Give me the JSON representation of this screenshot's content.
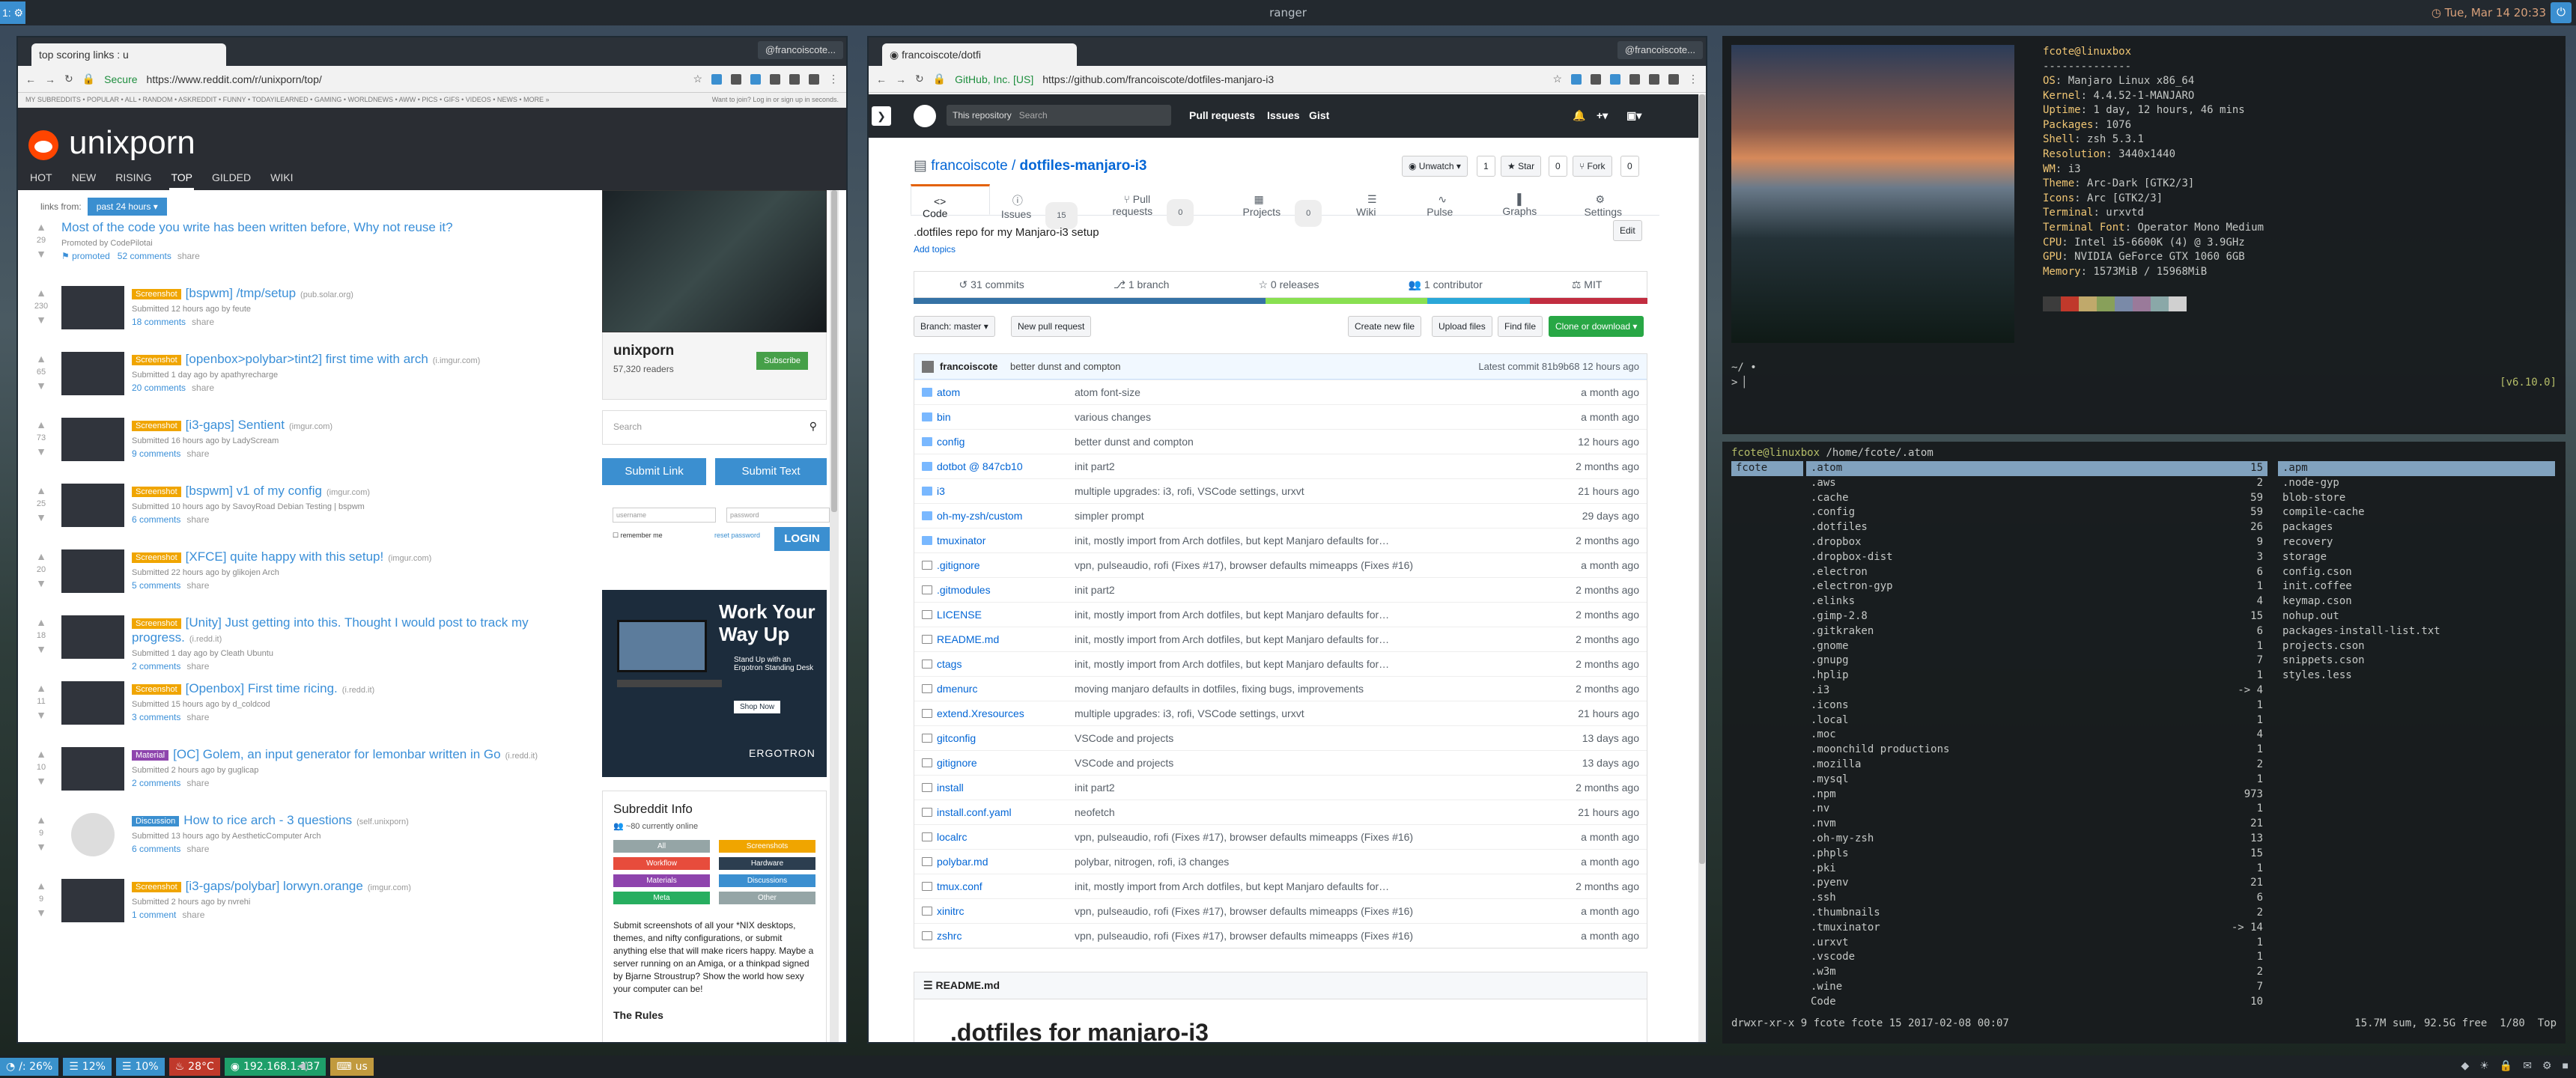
{
  "topbar": {
    "workspace": "1: ⚙",
    "title": "ranger",
    "clock": "◷ Tue, Mar 14 20:33",
    "power": "⏻"
  },
  "bottombar": {
    "items": [
      {
        "label": "/: 26%",
        "color": "#3a92cc"
      },
      {
        "label": "12%",
        "color": "#3a92cc"
      },
      {
        "label": "10%",
        "color": "#3a92cc"
      },
      {
        "label": "28°C",
        "color": "#c0392b"
      },
      {
        "label": "192.168.1.137",
        "color": "#1e9f6a"
      },
      {
        "label": "us",
        "color": "#c19a3e"
      }
    ],
    "volume": "◀)"
  },
  "reddit": {
    "tab": "top scoring links : u",
    "profile": "@francoiscote...",
    "secure": "Secure",
    "url": "https://www.reddit.com/r/unixporn/top/",
    "strip": "MY SUBREDDITS • POPULAR • ALL • RANDOM • ASKREDDIT • FUNNY • TODAYILEARNED • GAMING • WORLDNEWS • AWW • PICS • GIFS • VIDEOS • NEWS • MORE »",
    "login_prompt": "Want to join? Log in or sign up in seconds.",
    "sub": "unixporn",
    "tabs": [
      "HOT",
      "NEW",
      "RISING",
      "TOP",
      "GILDED",
      "WIKI"
    ],
    "links_from": "links from:",
    "filter": "past 24 hours ▾",
    "posts": [
      {
        "title": "Most of the code you write has been written before, Why not reuse it?",
        "flair": "",
        "domain": "",
        "score": "29",
        "meta": "Promoted by CodePilotai",
        "comments": "52 comments",
        "share": "share",
        "promoted": "⚑ promoted"
      },
      {
        "title": "[bspwm] /tmp/setup",
        "flair": "Screenshot",
        "domain": "(pub.solar.org)",
        "score": "230",
        "meta": "Submitted 12 hours ago by feute",
        "comments": "18 comments",
        "share": "share"
      },
      {
        "title": "[openbox>polybar>tint2] first time with arch",
        "flair": "Screenshot",
        "domain": "(i.imgur.com)",
        "score": "65",
        "meta": "Submitted 1 day ago by apathyrecharge",
        "comments": "20 comments",
        "share": "share"
      },
      {
        "title": "[i3-gaps] Sentient",
        "flair": "Screenshot",
        "domain": "(imgur.com)",
        "score": "73",
        "meta": "Submitted 16 hours ago by LadyScream",
        "comments": "9 comments",
        "share": "share"
      },
      {
        "title": "[bspwm] v1 of my config",
        "flair": "Screenshot",
        "domain": "(imgur.com)",
        "score": "25",
        "meta": "Submitted 10 hours ago by SavoyRoad  Debian Testing | bspwm",
        "comments": "6 comments",
        "share": "share"
      },
      {
        "title": "[XFCE] quite happy with this setup!",
        "flair": "Screenshot",
        "domain": "(imgur.com)",
        "score": "20",
        "meta": "Submitted 22 hours ago by glikojen  Arch",
        "comments": "5 comments",
        "share": "share"
      },
      {
        "title": "[Unity] Just getting into this. Thought I would post to track my progress.",
        "flair": "Screenshot",
        "domain": "(i.redd.it)",
        "score": "18",
        "meta": "Submitted 1 day ago by Cleath  Ubuntu",
        "comments": "2 comments",
        "share": "share"
      },
      {
        "title": "[Openbox] First time ricing.",
        "flair": "Screenshot",
        "domain": "(i.redd.it)",
        "score": "11",
        "meta": "Submitted 15 hours ago by d_coldcod",
        "comments": "3 comments",
        "share": "share"
      },
      {
        "title": "[OC] Golem, an input generator for lemonbar written in Go",
        "flair": "Material",
        "domain": "(i.redd.it)",
        "score": "10",
        "meta": "Submitted 2 hours ago by guglicap",
        "comments": "2 comments",
        "share": "share"
      },
      {
        "title": "How to rice arch - 3 questions",
        "flair": "Discussion",
        "domain": "(self.unixporn)",
        "score": "9",
        "meta": "Submitted 13 hours ago by AestheticComputer  Arch",
        "comments": "6 comments",
        "share": "share"
      },
      {
        "title": "[i3-gaps/polybar] lorwyn.orange",
        "flair": "Screenshot",
        "domain": "(imgur.com)",
        "score": "9",
        "meta": "Submitted 2 hours ago by nvrehi",
        "comments": "1 comment",
        "share": "share"
      }
    ],
    "side": {
      "sub": "unixporn",
      "readers": "57,320 readers",
      "subscribe": "Subscribe",
      "search": "Search",
      "submit_link": "Submit Link",
      "submit_text": "Submit Text",
      "username": "username",
      "password": "password",
      "remember": "remember me",
      "reset": "reset password",
      "login": "LOGIN",
      "ad_title": "Work Your Way Up",
      "ad_sub": "Stand Up with an Ergotron Standing Desk",
      "ad_btn": "Shop Now",
      "ad_brand": "ERGOTRON",
      "info_title": "Subreddit Info",
      "online": "~80 currently online",
      "tags": [
        {
          "l": "All",
          "c": "#95a5a6"
        },
        {
          "l": "Screenshots",
          "c": "#f0a500"
        },
        {
          "l": "Workflow",
          "c": "#e74c3c"
        },
        {
          "l": "Hardware",
          "c": "#2c3e50"
        },
        {
          "l": "Materials",
          "c": "#8e44ad"
        },
        {
          "l": "Discussions",
          "c": "#3b8fd0"
        },
        {
          "l": "Meta",
          "c": "#27ae60"
        },
        {
          "l": "Other",
          "c": "#95a5a6"
        }
      ],
      "desc": "Submit screenshots of all your *NIX desktops, themes, and nifty configurations, or submit anything else that will make ricers happy. Maybe a server running on an Amiga, or a thinkpad signed by Bjarne Stroustrup? Show the world how sexy your computer can be!",
      "rules": "The Rules"
    }
  },
  "github": {
    "tab": "francoiscote/dotfi",
    "profile": "@francoiscote...",
    "secure": "GitHub, Inc. [US]",
    "url": "https://github.com/francoiscote/dotfiles-manjaro-i3",
    "repo_scope": "This repository",
    "search": "Search",
    "nav": [
      "Pull requests",
      "Issues",
      "Gist"
    ],
    "owner": "francoiscote",
    "repo": "dotfiles-manjaro-i3",
    "unwatch": "◉ Unwatch ▾",
    "watch_count": "1",
    "star": "★ Star",
    "star_count": "0",
    "fork": "⑂ Fork",
    "fork_count": "0",
    "tabs": [
      {
        "l": "<> Code",
        "c": ""
      },
      {
        "l": "ⓘ Issues",
        "c": "15"
      },
      {
        "l": "⑂ Pull requests",
        "c": "0"
      },
      {
        "l": "▦ Projects",
        "c": "0"
      },
      {
        "l": "☰ Wiki",
        "c": ""
      },
      {
        "l": "∿ Pulse",
        "c": ""
      },
      {
        "l": "▐ Graphs",
        "c": ""
      },
      {
        "l": "⚙ Settings",
        "c": ""
      }
    ],
    "desc": ".dotfiles repo for my Manjaro-i3 setup",
    "edit": "Edit",
    "topics": "Add topics",
    "summary": [
      "31 commits",
      "1 branch",
      "0 releases",
      "1 contributor",
      "MIT"
    ],
    "lang": [
      {
        "c": "#3572a5",
        "w": 48
      },
      {
        "c": "#89e051",
        "w": 22
      },
      {
        "c": "#2aa7d8",
        "w": 14
      },
      {
        "c": "#c22d40",
        "w": 16
      }
    ],
    "branch": "Branch: master ▾",
    "new_pr": "New pull request",
    "create": "Create new file",
    "upload": "Upload files",
    "find": "Find file",
    "clone": "Clone or download ▾",
    "latest_user": "francoiscote",
    "latest_msg": "better dunst and compton",
    "latest_commit": "Latest commit 81b9b68 12 hours ago",
    "files": [
      {
        "n": "atom",
        "d": true,
        "m": "atom font-size",
        "a": "a month ago"
      },
      {
        "n": "bin",
        "d": true,
        "m": "various changes",
        "a": "a month ago"
      },
      {
        "n": "config",
        "d": true,
        "m": "better dunst and compton",
        "a": "12 hours ago"
      },
      {
        "n": "dotbot @ 847cb10",
        "d": true,
        "m": "init part2",
        "a": "2 months ago"
      },
      {
        "n": "i3",
        "d": true,
        "m": "multiple upgrades: i3, rofi, VSCode settings, urxvt",
        "a": "21 hours ago"
      },
      {
        "n": "oh-my-zsh/custom",
        "d": true,
        "m": "simpler prompt",
        "a": "29 days ago"
      },
      {
        "n": "tmuxinator",
        "d": true,
        "m": "init, mostly import from Arch dotfiles, but kept Manjaro defaults for…",
        "a": "2 months ago"
      },
      {
        "n": ".gitignore",
        "d": false,
        "m": "vpn, pulseaudio, rofi (Fixes #17), browser defaults mimeapps (Fixes #16)",
        "a": "a month ago"
      },
      {
        "n": ".gitmodules",
        "d": false,
        "m": "init part2",
        "a": "2 months ago"
      },
      {
        "n": "LICENSE",
        "d": false,
        "m": "init, mostly import from Arch dotfiles, but kept Manjaro defaults for…",
        "a": "2 months ago"
      },
      {
        "n": "README.md",
        "d": false,
        "m": "init, mostly import from Arch dotfiles, but kept Manjaro defaults for…",
        "a": "2 months ago"
      },
      {
        "n": "ctags",
        "d": false,
        "m": "init, mostly import from Arch dotfiles, but kept Manjaro defaults for…",
        "a": "2 months ago"
      },
      {
        "n": "dmenurc",
        "d": false,
        "m": "moving manjaro defaults in dotfiles, fixing bugs, improvements",
        "a": "2 months ago"
      },
      {
        "n": "extend.Xresources",
        "d": false,
        "m": "multiple upgrades: i3, rofi, VSCode settings, urxvt",
        "a": "21 hours ago"
      },
      {
        "n": "gitconfig",
        "d": false,
        "m": "VSCode and projects",
        "a": "13 days ago"
      },
      {
        "n": "gitignore",
        "d": false,
        "m": "VSCode and projects",
        "a": "13 days ago"
      },
      {
        "n": "install",
        "d": false,
        "m": "init part2",
        "a": "2 months ago"
      },
      {
        "n": "install.conf.yaml",
        "d": false,
        "m": "neofetch",
        "a": "21 hours ago"
      },
      {
        "n": "localrc",
        "d": false,
        "m": "vpn, pulseaudio, rofi (Fixes #17), browser defaults mimeapps (Fixes #16)",
        "a": "a month ago"
      },
      {
        "n": "polybar.md",
        "d": false,
        "m": "polybar, nitrogen, rofi, i3 changes",
        "a": "a month ago"
      },
      {
        "n": "tmux.conf",
        "d": false,
        "m": "init, mostly import from Arch dotfiles, but kept Manjaro defaults for…",
        "a": "2 months ago"
      },
      {
        "n": "xinitrc",
        "d": false,
        "m": "vpn, pulseaudio, rofi (Fixes #17), browser defaults mimeapps (Fixes #16)",
        "a": "a month ago"
      },
      {
        "n": "zshrc",
        "d": false,
        "m": "vpn, pulseaudio, rofi (Fixes #17), browser defaults mimeapps (Fixes #16)",
        "a": "a month ago"
      }
    ],
    "readme_label": "README.md",
    "readme_title": ".dotfiles for manjaro-i3"
  },
  "neofetch": {
    "header": "fcote@linuxbox",
    "rule": "--------------",
    "lines": [
      [
        "OS",
        "Manjaro Linux x86_64"
      ],
      [
        "Kernel",
        "4.4.52-1-MANJARO"
      ],
      [
        "Uptime",
        "1 day, 12 hours, 46 mins"
      ],
      [
        "Packages",
        "1076"
      ],
      [
        "Shell",
        "zsh 5.3.1"
      ],
      [
        "Resolution",
        "3440x1440"
      ],
      [
        "WM",
        "i3"
      ],
      [
        "Theme",
        "Arc-Dark [GTK2/3]"
      ],
      [
        "Icons",
        "Arc [GTK2/3]"
      ],
      [
        "Terminal",
        "urxvtd"
      ],
      [
        "Terminal Font",
        "Operator Mono Medium"
      ],
      [
        "CPU",
        "Intel i5-6600K (4) @ 3.9GHz"
      ],
      [
        "GPU",
        "NVIDIA GeForce GTX 1060 6GB"
      ],
      [
        "Memory",
        "1573MiB / 15968MiB"
      ]
    ],
    "swatches": [
      "#3c3c3c",
      "#c0392b",
      "#c0a96b",
      "#88a05a",
      "#7a8aa8",
      "#9a7a9a",
      "#8aa8a8",
      "#d0d0d0"
    ],
    "prompt": "~/ •",
    "cursor": "> ▏",
    "version": "[v6.10.0]"
  },
  "ranger": {
    "path_user": "fcote@linuxbox",
    "path": "/home/fcote/.atom",
    "parent": "fcote",
    "items": [
      [
        ".atom",
        "15"
      ],
      [
        ".aws",
        "2"
      ],
      [
        ".cache",
        "59"
      ],
      [
        ".config",
        "59"
      ],
      [
        ".dotfiles",
        "26"
      ],
      [
        ".dropbox",
        "9"
      ],
      [
        ".dropbox-dist",
        "3"
      ],
      [
        ".electron",
        "6"
      ],
      [
        ".electron-gyp",
        "1"
      ],
      [
        ".elinks",
        "4"
      ],
      [
        ".gimp-2.8",
        "15"
      ],
      [
        ".gitkraken",
        "6"
      ],
      [
        ".gnome",
        "1"
      ],
      [
        ".gnupg",
        "7"
      ],
      [
        ".hplip",
        "1"
      ],
      [
        ".i3",
        "-> 4"
      ],
      [
        ".icons",
        "1"
      ],
      [
        ".local",
        "1"
      ],
      [
        ".moc",
        "4"
      ],
      [
        ".moonchild productions",
        "1"
      ],
      [
        ".mozilla",
        "2"
      ],
      [
        ".mysql",
        "1"
      ],
      [
        ".npm",
        "973"
      ],
      [
        ".nv",
        "1"
      ],
      [
        ".nvm",
        "21"
      ],
      [
        ".oh-my-zsh",
        "13"
      ],
      [
        ".phpls",
        "15"
      ],
      [
        ".pki",
        "1"
      ],
      [
        ".pyenv",
        "21"
      ],
      [
        ".ssh",
        "6"
      ],
      [
        ".thumbnails",
        "2"
      ],
      [
        ".tmuxinator",
        "-> 14"
      ],
      [
        ".urxvt",
        "1"
      ],
      [
        ".vscode",
        "1"
      ],
      [
        ".w3m",
        "2"
      ],
      [
        ".wine",
        "7"
      ],
      [
        "Code",
        "10"
      ]
    ],
    "preview": [
      ".apm",
      ".node-gyp",
      "blob-store",
      "compile-cache",
      "packages",
      "recovery",
      "storage",
      "config.cson",
      "init.coffee",
      "keymap.cson",
      "nohup.out",
      "packages-install-list.txt",
      "projects.cson",
      "snippets.cson",
      "styles.less"
    ],
    "status_left": "drwxr-xr-x 9 fcote fcote 15 2017-02-08 00:07",
    "status_right": "15.7M sum, 92.5G free  1/80  Top"
  }
}
